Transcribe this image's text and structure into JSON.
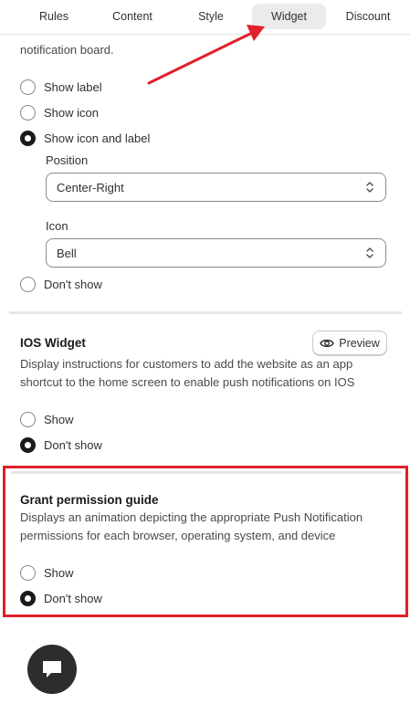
{
  "tabs": [
    "Rules",
    "Content",
    "Style",
    "Widget",
    "Discount"
  ],
  "active_tab": "Widget",
  "board_widget": {
    "desc_tail": "notification board.",
    "options": [
      {
        "label": "Show label",
        "checked": false
      },
      {
        "label": "Show icon",
        "checked": false
      },
      {
        "label": "Show icon and label",
        "checked": true
      }
    ],
    "position_label": "Position",
    "position_value": "Center-Right",
    "icon_label": "Icon",
    "icon_value": "Bell",
    "dont_show": {
      "label": "Don't show",
      "checked": false
    }
  },
  "ios_widget": {
    "title": "IOS Widget",
    "preview_label": "Preview",
    "description": "Display instructions for customers to add the website as an app shortcut to the home screen to enable push notifications on IOS",
    "options": [
      {
        "label": "Show",
        "checked": false
      },
      {
        "label": "Don't show",
        "checked": true
      }
    ]
  },
  "grant_permission": {
    "title": "Grant permission guide",
    "description": "Displays an animation depicting the appropriate Push Notification permissions for each browser, operating system, and device",
    "options": [
      {
        "label": "Show",
        "checked": false
      },
      {
        "label": "Don't show",
        "checked": true
      }
    ]
  },
  "colors": {
    "highlight": "#e0202b",
    "accent_dark": "#1a1a1a",
    "active_tab_bg": "#ebebeb"
  },
  "icons": [
    "eye-icon",
    "chevron-updown-icon",
    "chat-bubble-icon",
    "red-arrow-annotation"
  ]
}
